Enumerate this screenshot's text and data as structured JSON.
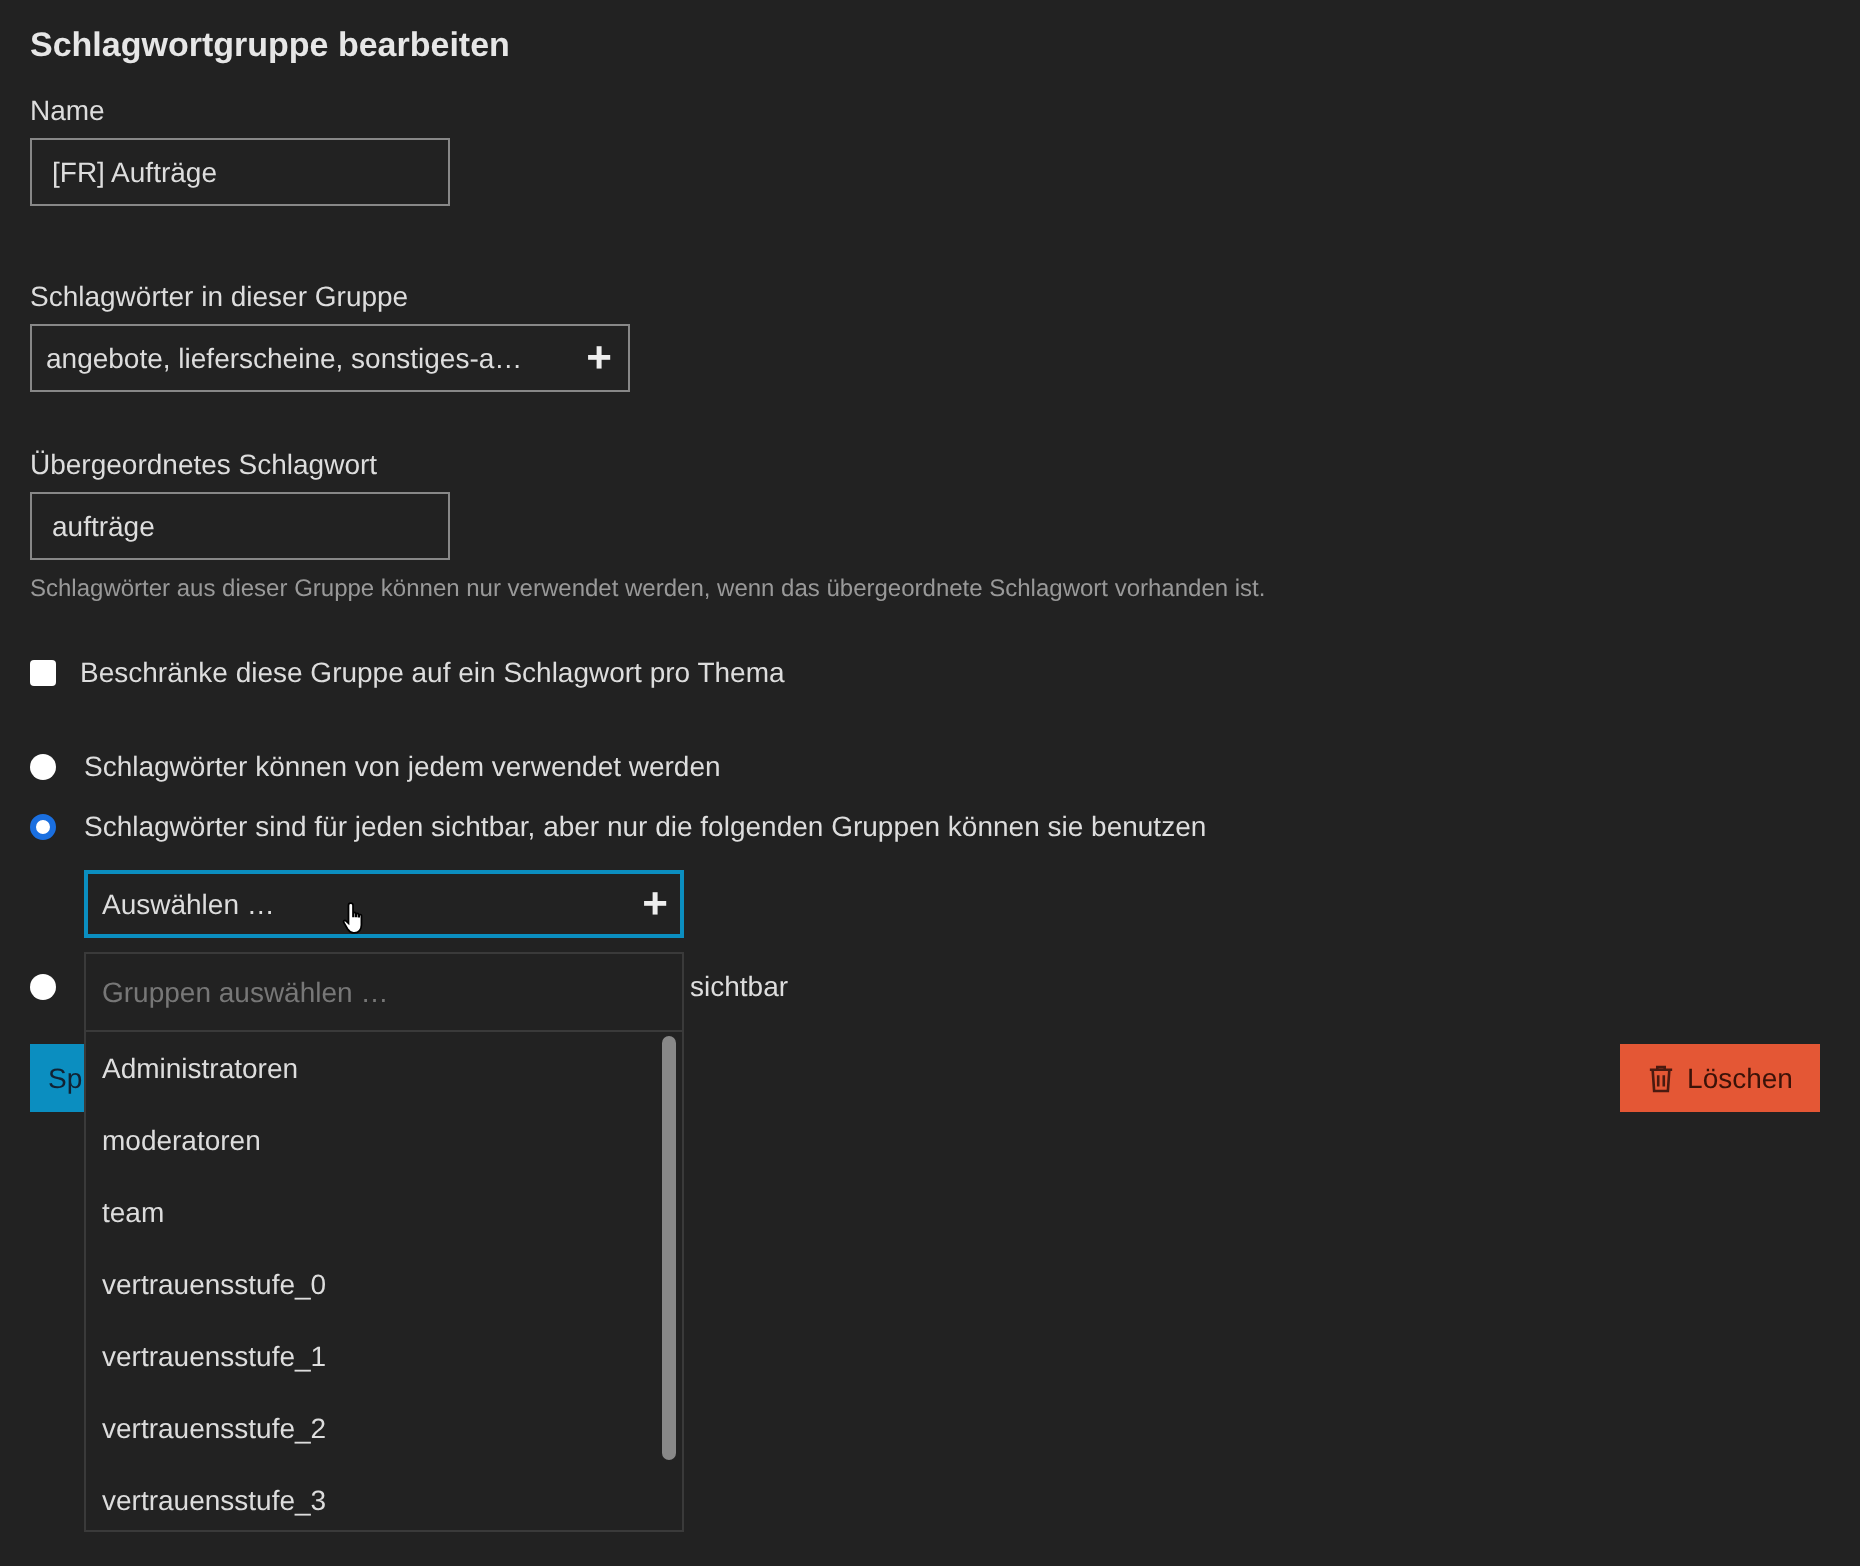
{
  "title": "Schlagwortgruppe bearbeiten",
  "name_field": {
    "label": "Name",
    "value": "[FR] Aufträge"
  },
  "tags_field": {
    "label": "Schlagwörter in dieser Gruppe",
    "value": "angebote, lieferscheine, sonstiges-a…",
    "button": "+"
  },
  "parent_field": {
    "label": "Übergeordnetes Schlagwort",
    "value": "aufträge",
    "help": "Schlagwörter aus dieser Gruppe können nur verwendet werden, wenn das übergeordnete Schlagwort vorhanden ist."
  },
  "one_per_topic": {
    "label": "Beschränke diese Gruppe auf ein Schlagwort pro Thema",
    "checked": false
  },
  "permissions": [
    {
      "label": "Schlagwörter können von jedem verwendet werden",
      "selected": false
    },
    {
      "label": "Schlagwörter sind für jeden sichtbar, aber nur die folgenden Gruppen können sie benutzen",
      "selected": true
    },
    {
      "label": "sichtbar",
      "selected": false
    }
  ],
  "group_select": {
    "value": "Auswählen …",
    "button": "+",
    "filter_placeholder": "Gruppen auswählen …",
    "options": [
      "Administratoren",
      "moderatoren",
      "team",
      "vertrauensstufe_0",
      "vertrauensstufe_1",
      "vertrauensstufe_2",
      "vertrauensstufe_3"
    ]
  },
  "save_button": "Sp",
  "delete_button": "Löschen"
}
